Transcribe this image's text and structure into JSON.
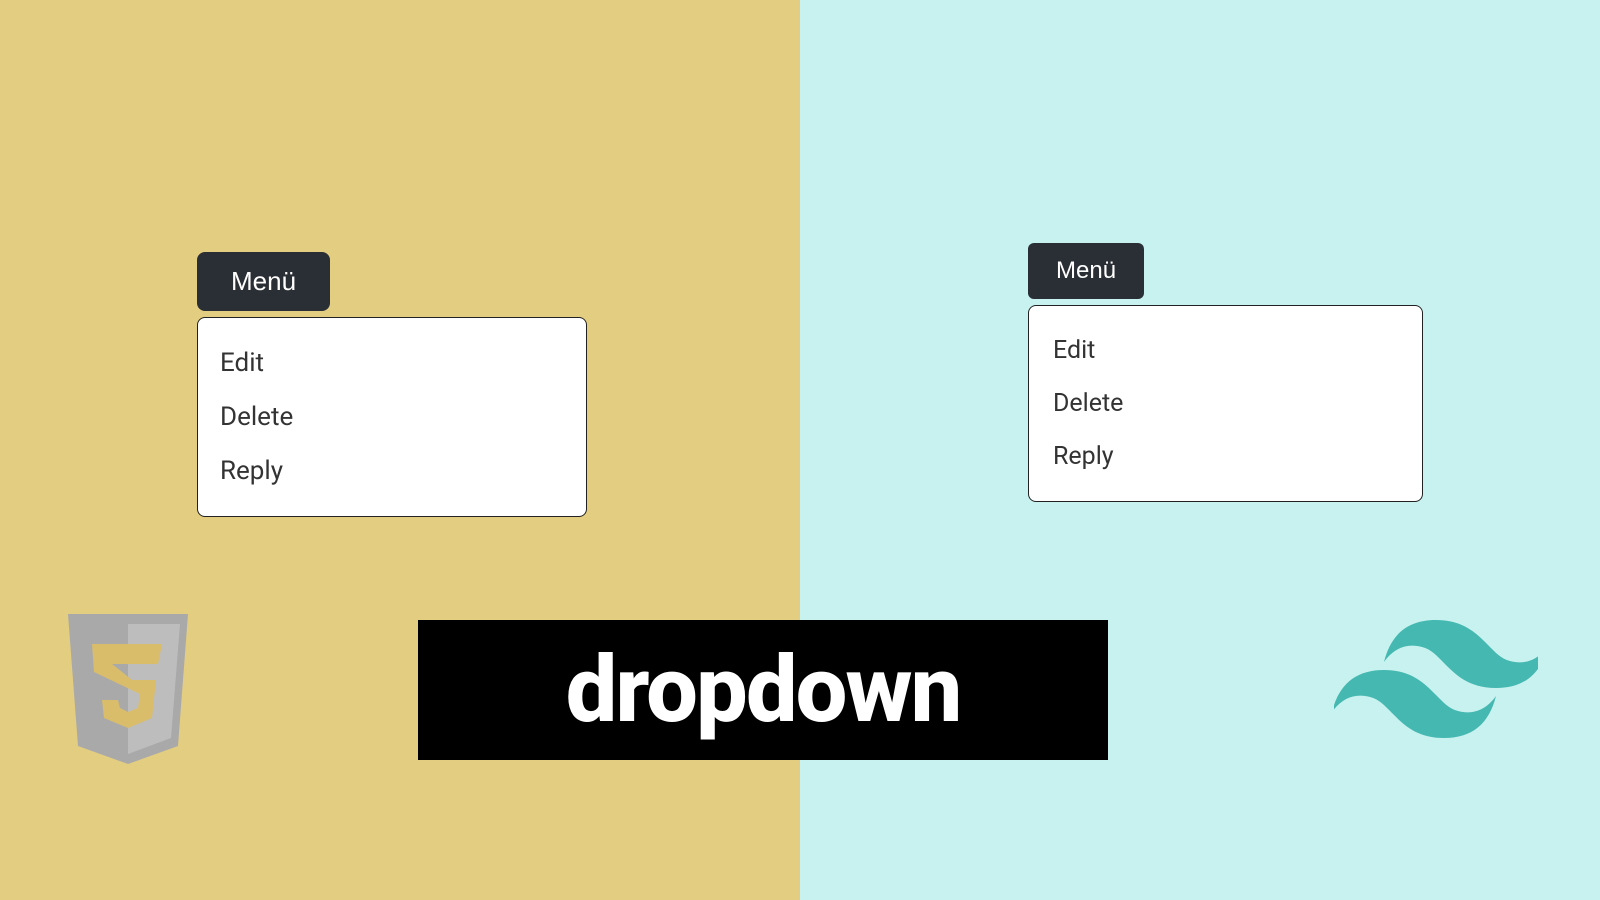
{
  "colors": {
    "left_bg": "#e3cd81",
    "right_bg": "#c8f2ef",
    "button_bg": "#2a2e35",
    "button_fg": "#ffffff",
    "panel_bg": "#ffffff",
    "panel_border": "#222222",
    "banner_bg": "#000000",
    "banner_fg": "#ffffff",
    "tailwind": "#44b8b1",
    "css3_outer": "#a9a9a9",
    "css3_inner": "#d9bd6a"
  },
  "left": {
    "button_label": "Menü",
    "items": [
      "Edit",
      "Delete",
      "Reply"
    ]
  },
  "right": {
    "button_label": "Menü",
    "items": [
      "Edit",
      "Delete",
      "Reply"
    ]
  },
  "banner": {
    "label": "dropdown"
  },
  "icons": {
    "css3": "css3-logo-icon",
    "tailwind": "tailwind-logo-icon"
  }
}
